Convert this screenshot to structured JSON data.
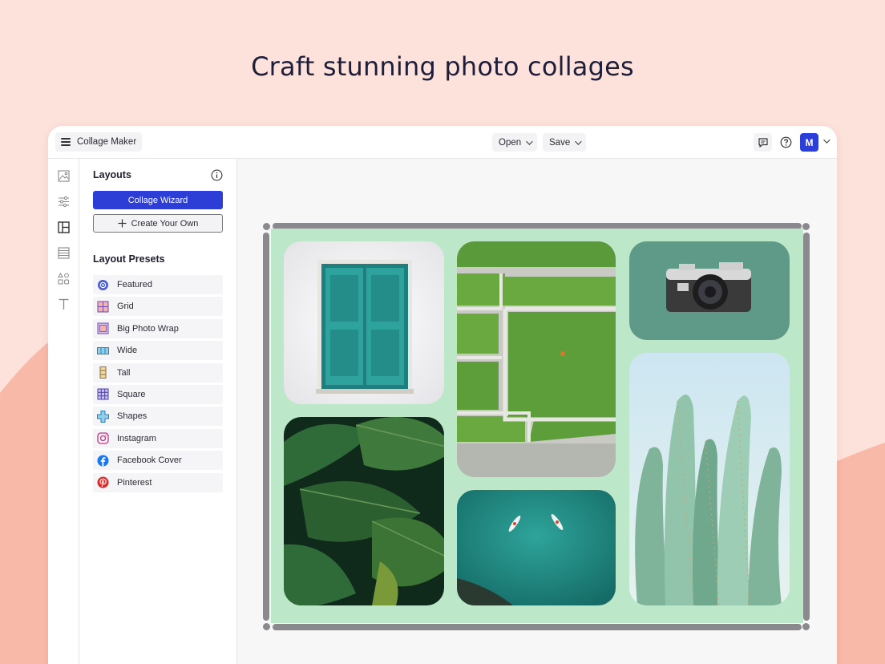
{
  "headline": "Craft stunning photo collages",
  "colors": {
    "background": "#fde2db",
    "wave": "#f9b9a9",
    "accent": "#2c3ed6",
    "collage_background": "#bde7c9"
  },
  "topbar": {
    "menu_icon": "hamburger-icon",
    "app_name": "Collage Maker",
    "open_label": "Open",
    "save_label": "Save",
    "comment_icon": "comment-icon",
    "help_icon": "help-icon",
    "avatar_initial": "M"
  },
  "rail": {
    "icons": [
      "image-icon",
      "sliders-icon",
      "layout-icon",
      "texture-icon",
      "shapes-icon",
      "text-icon"
    ]
  },
  "panel": {
    "title": "Layouts",
    "info_icon": "info-icon",
    "wizard_label": "Collage Wizard",
    "create_label": "Create Your Own",
    "presets_title": "Layout Presets",
    "presets": [
      {
        "label": "Featured",
        "icon": "featured-icon"
      },
      {
        "label": "Grid",
        "icon": "grid-icon"
      },
      {
        "label": "Big Photo Wrap",
        "icon": "big-photo-wrap-icon"
      },
      {
        "label": "Wide",
        "icon": "wide-icon"
      },
      {
        "label": "Tall",
        "icon": "tall-icon"
      },
      {
        "label": "Square",
        "icon": "square-icon"
      },
      {
        "label": "Shapes",
        "icon": "shapes-preset-icon"
      },
      {
        "label": "Instagram",
        "icon": "instagram-icon"
      },
      {
        "label": "Facebook Cover",
        "icon": "facebook-icon"
      },
      {
        "label": "Pinterest",
        "icon": "pinterest-icon"
      }
    ]
  },
  "collage": {
    "photos": [
      "teal-door-photo",
      "green-rooftop-photo",
      "vintage-camera-photo",
      "monstera-leaves-photo",
      "kayaks-sea-photo",
      "cactus-photo"
    ]
  }
}
